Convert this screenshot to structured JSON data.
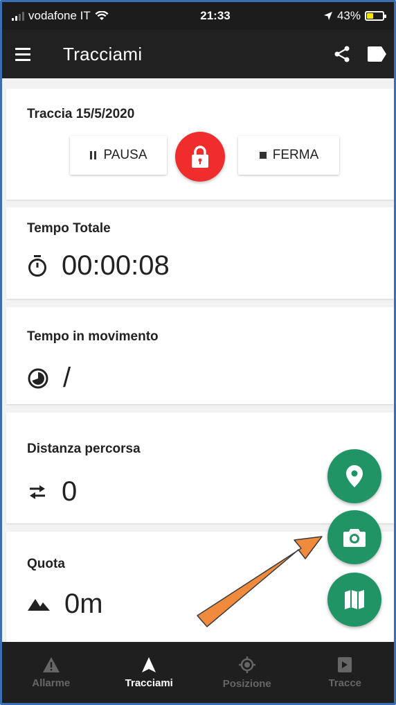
{
  "status_bar": {
    "carrier": "vodafone IT",
    "time": "21:33",
    "battery_percent": "43%",
    "battery_level": 0.43
  },
  "app_bar": {
    "title": "Tracciami",
    "menu_icon": "menu-icon",
    "share_icon": "share-icon",
    "label_icon": "label-icon"
  },
  "track_card": {
    "title": "Traccia 15/5/2020",
    "pause_label": "PAUSA",
    "stop_label": "FERMA"
  },
  "stats": [
    {
      "label": "Tempo Totale",
      "value": "00:00:08",
      "icon": "stopwatch-icon"
    },
    {
      "label": "Tempo in movimento",
      "value": "/",
      "icon": "pie-clock-icon"
    },
    {
      "label": "Distanza percorsa",
      "value": "0",
      "icon": "swap-arrows-icon"
    },
    {
      "label": "Quota",
      "value": "0m",
      "icon": "mountain-icon"
    }
  ],
  "fabs": [
    "location-pin-icon",
    "camera-icon",
    "map-icon"
  ],
  "bottom_nav": [
    {
      "label": "Allarme",
      "icon": "warning-icon",
      "active": false
    },
    {
      "label": "Tracciami",
      "icon": "navigation-arrow-icon",
      "active": true
    },
    {
      "label": "Posizione",
      "icon": "gps-fixed-icon",
      "active": false
    },
    {
      "label": "Tracce",
      "icon": "tracks-icon",
      "active": false
    }
  ],
  "colors": {
    "accent_green": "#219466",
    "lock_red": "#ef2d2d",
    "app_bar": "#212121",
    "annotation_arrow": "#f08a3c"
  }
}
